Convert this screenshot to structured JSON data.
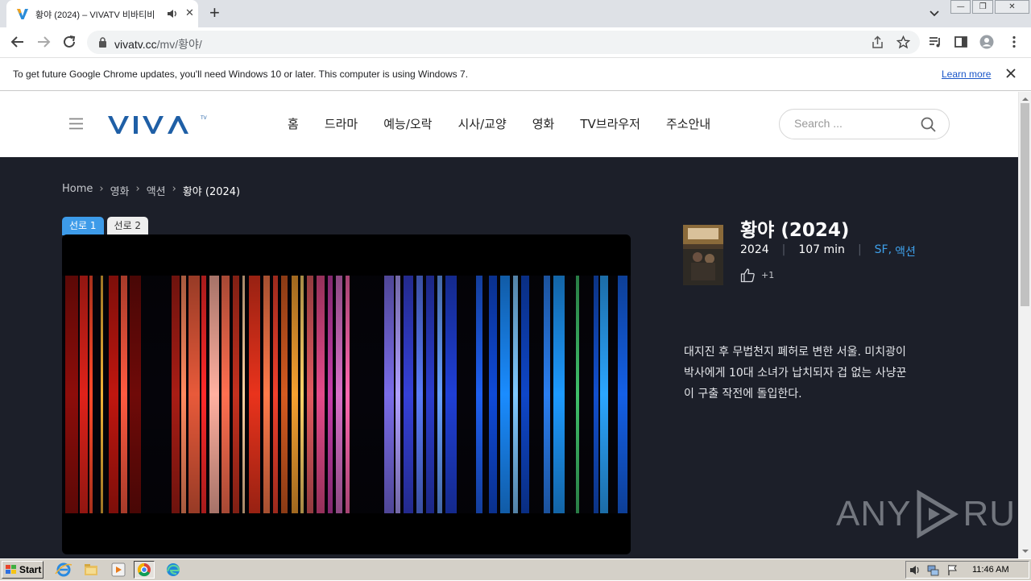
{
  "browser": {
    "tab": {
      "title": "황야 (2024) – VIVATV 비바티비",
      "favicon": "viva-v-icon"
    },
    "new_tab_label": "+",
    "url_prefix": "vivatv.cc",
    "url_path": "/mv/황야/",
    "infobar": {
      "message": "To get future Google Chrome updates, you'll need Windows 10 or later. This computer is using Windows 7.",
      "link": "Learn more"
    }
  },
  "site": {
    "logo_text": "VIVA",
    "logo_tm": "TV",
    "nav": [
      "홈",
      "드라마",
      "예능/오락",
      "시사/교양",
      "영화",
      "TV브라우저",
      "주소안내"
    ],
    "search_placeholder": "Search ..."
  },
  "breadcrumb": {
    "items": [
      "Home",
      "영화",
      "액션"
    ],
    "current": "황야 (2024)",
    "separator": "›"
  },
  "servers": [
    "선로 1",
    "선로 2"
  ],
  "movie": {
    "title": "황야 (2024)",
    "year": "2024",
    "runtime": "107 min",
    "genres": [
      "SF",
      "액션"
    ],
    "likes": "+1",
    "synopsis": "대지진 후 무법천지 폐허로 변한 서울. 미치광이 박사에게 10대 소녀가 납치되자 겁 없는 사냥꾼이 구출 작전에 돌입한다."
  },
  "watermark": {
    "left": "ANY",
    "right": "RUN"
  },
  "taskbar": {
    "start_label": "Start",
    "clock": "11:46 AM"
  },
  "colors": {
    "page_bg": "#1c1f29",
    "accent_blue": "#3d9be9",
    "logo_blue": "#1f5fa6"
  }
}
